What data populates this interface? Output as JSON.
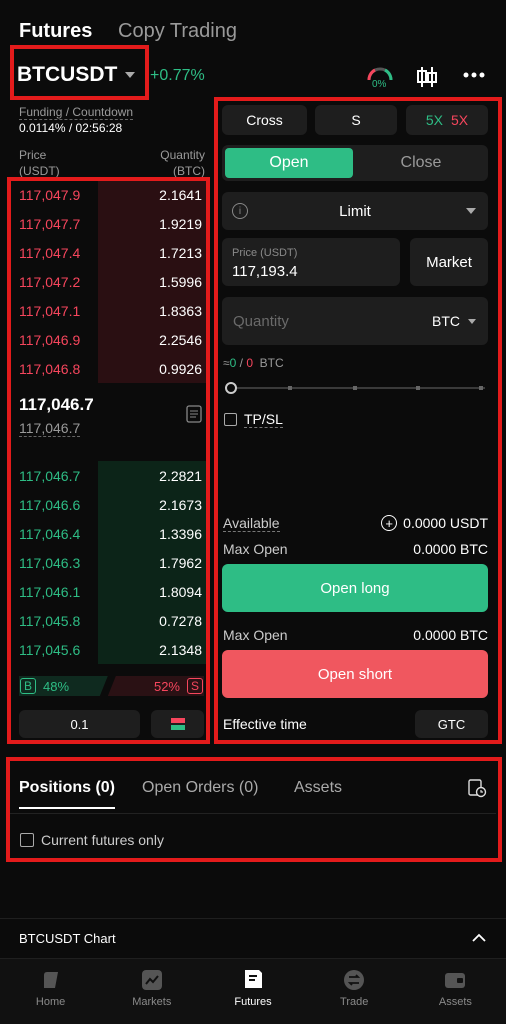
{
  "top_tabs": {
    "futures": "Futures",
    "copy": "Copy Trading"
  },
  "symbol": {
    "name": "BTCUSDT",
    "change": "+0.77%",
    "gauge_pct": "0%"
  },
  "funding": {
    "label": "Funding / Countdown",
    "value": "0.0114% / 02:56:28"
  },
  "book_headers": {
    "price": "Price\n(USDT)",
    "quantity": "Quantity\n(BTC)"
  },
  "asks": [
    {
      "price": "117,047.9",
      "qty": "2.1641",
      "depth": 0.55
    },
    {
      "price": "117,047.7",
      "qty": "1.9219",
      "depth": 0.55
    },
    {
      "price": "117,047.4",
      "qty": "1.7213",
      "depth": 0.55
    },
    {
      "price": "117,047.2",
      "qty": "1.5996",
      "depth": 0.55
    },
    {
      "price": "117,047.1",
      "qty": "1.8363",
      "depth": 0.55
    },
    {
      "price": "117,046.9",
      "qty": "2.2546",
      "depth": 0.55
    },
    {
      "price": "117,046.8",
      "qty": "0.9926",
      "depth": 0.55
    }
  ],
  "mid": {
    "price": "117,046.7",
    "mark": "117,046.7"
  },
  "bids": [
    {
      "price": "117,046.7",
      "qty": "2.2821",
      "depth": 0.55
    },
    {
      "price": "117,046.6",
      "qty": "2.1673",
      "depth": 0.55
    },
    {
      "price": "117,046.4",
      "qty": "1.3396",
      "depth": 0.55
    },
    {
      "price": "117,046.3",
      "qty": "1.7962",
      "depth": 0.55
    },
    {
      "price": "117,046.1",
      "qty": "1.8094",
      "depth": 0.55
    },
    {
      "price": "117,045.8",
      "qty": "0.7278",
      "depth": 0.55
    },
    {
      "price": "117,045.6",
      "qty": "2.1348",
      "depth": 0.55
    }
  ],
  "ratio": {
    "buy_tag": "B",
    "buy_pct": "48%",
    "sell_pct": "52%",
    "sell_tag": "S",
    "buy_frac": 0.48
  },
  "precision": "0.1",
  "order": {
    "cross": "Cross",
    "mode": "S",
    "lev_long": "5X",
    "lev_short": "5X",
    "open": "Open",
    "close": "Close",
    "type": "Limit",
    "price_label": "Price (USDT)",
    "price_value": "117,193.4",
    "market": "Market",
    "qty_placeholder": "Quantity",
    "qty_unit": "BTC",
    "approx_prefix": "≈",
    "approx_long": "0",
    "approx_sep": "/",
    "approx_short": "0",
    "approx_unit": "BTC",
    "slider_value": 0,
    "tpsl": "TP/SL",
    "available_label": "Available",
    "available_value": "0.0000 USDT",
    "max_open_label": "Max Open",
    "max_open_long": "0.0000 BTC",
    "open_long": "Open long",
    "max_open_short": "0.0000 BTC",
    "open_short": "Open short",
    "effective_label": "Effective time",
    "effective_value": "GTC"
  },
  "bottom_tabs": {
    "positions": "Positions (0)",
    "orders": "Open Orders (0)",
    "assets": "Assets",
    "filter": "Current futures only"
  },
  "chart_bar": {
    "label": "BTCUSDT Chart"
  },
  "nav": [
    {
      "label": "Home",
      "icon": "home-icon"
    },
    {
      "label": "Markets",
      "icon": "markets-icon"
    },
    {
      "label": "Futures",
      "icon": "futures-icon"
    },
    {
      "label": "Trade",
      "icon": "trade-icon"
    },
    {
      "label": "Assets",
      "icon": "wallet-icon"
    }
  ],
  "colors": {
    "green": "#2ebd85",
    "red": "#f6465d",
    "highlight": "#e31b1b",
    "bg": "#0b0b0b"
  }
}
